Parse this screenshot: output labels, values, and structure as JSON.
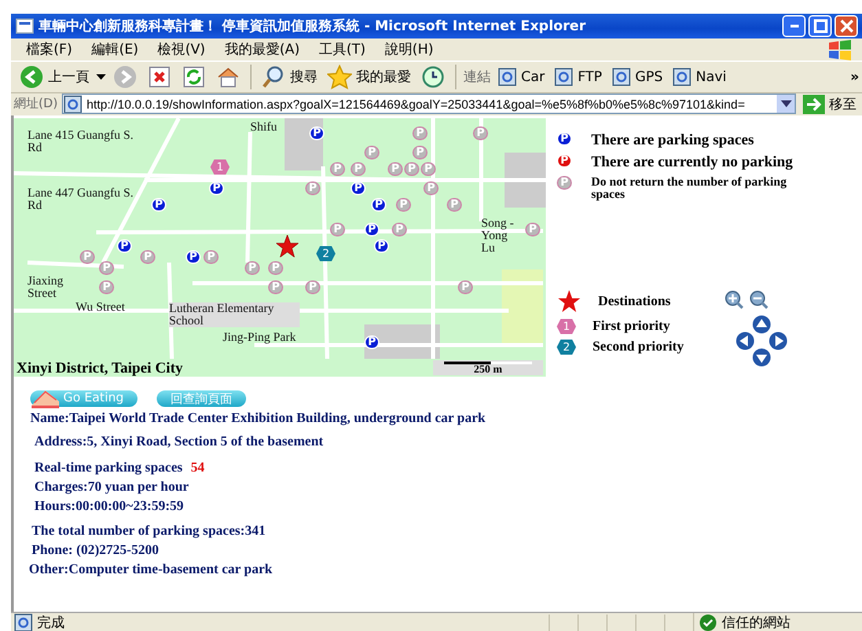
{
  "window": {
    "title": "車輛中心創新服務科專計畫！ 停車資訊加值服務系統 - Microsoft Internet Explorer"
  },
  "menu": [
    "檔案(F)",
    "編輯(E)",
    "檢視(V)",
    "我的最愛(A)",
    "工具(T)",
    "說明(H)"
  ],
  "toolbar": {
    "back": "上一頁",
    "search": "搜尋",
    "favorites": "我的最愛",
    "links_label": "連結",
    "links": [
      "Car",
      "FTP",
      "GPS",
      "Navi"
    ],
    "more": "»"
  },
  "address": {
    "label": "網址(D)",
    "value": "http://10.0.0.19/showInformation.aspx?goalX=121564469&goalY=25033441&goal=%e5%8f%b0%e5%8c%97101&kind=",
    "go": "移至"
  },
  "map": {
    "labels": [
      "Shifu",
      "Lane 415 Guangfu S. Rd",
      "Lane 447 Guangfu S. Rd",
      "Song -Yong Lu",
      "Jiaxing Street",
      "Wu Street",
      "Lutheran Elementary School",
      "Jing-Ping Park"
    ],
    "markers": [
      {
        "kind": "available",
        "label": "P"
      },
      {
        "kind": "unknown",
        "label": "P"
      },
      {
        "kind": "unknown",
        "label": "P"
      },
      {
        "kind": "unknown",
        "label": "P"
      },
      {
        "kind": "unknown",
        "label": "P"
      },
      {
        "kind": "unknown",
        "label": "P"
      },
      {
        "kind": "unknown",
        "label": "P"
      },
      {
        "kind": "unknown",
        "label": "P"
      },
      {
        "kind": "unknown",
        "label": "P"
      },
      {
        "kind": "unknown",
        "label": "P"
      },
      {
        "kind": "available",
        "label": "P"
      },
      {
        "kind": "unknown",
        "label": "P"
      },
      {
        "kind": "available",
        "label": "P"
      },
      {
        "kind": "unknown",
        "label": "P"
      },
      {
        "kind": "available",
        "label": "P"
      },
      {
        "kind": "available",
        "label": "P"
      },
      {
        "kind": "unknown",
        "label": "P"
      },
      {
        "kind": "unknown",
        "label": "P"
      },
      {
        "kind": "unknown",
        "label": "P"
      },
      {
        "kind": "available",
        "label": "P"
      },
      {
        "kind": "unknown",
        "label": "P"
      },
      {
        "kind": "unknown",
        "label": "P"
      },
      {
        "kind": "available",
        "label": "P"
      },
      {
        "kind": "available",
        "label": "P"
      },
      {
        "kind": "unknown",
        "label": "P"
      },
      {
        "kind": "unknown",
        "label": "P"
      },
      {
        "kind": "available",
        "label": "P"
      },
      {
        "kind": "unknown",
        "label": "P"
      },
      {
        "kind": "unknown",
        "label": "P"
      },
      {
        "kind": "unknown",
        "label": "P"
      },
      {
        "kind": "unknown",
        "label": "P"
      },
      {
        "kind": "unknown",
        "label": "P"
      },
      {
        "kind": "unknown",
        "label": "P"
      },
      {
        "kind": "unknown",
        "label": "P"
      },
      {
        "kind": "unknown",
        "label": "P"
      },
      {
        "kind": "available",
        "label": "P"
      }
    ],
    "priority_markers": [
      {
        "kind": "first",
        "label": "1"
      },
      {
        "kind": "second",
        "label": "2"
      }
    ],
    "caption": "Xinyi District, Taipei City",
    "scale": "250 m"
  },
  "legend": [
    {
      "kind": "available",
      "icon_label": "P",
      "text": "There are parking spaces"
    },
    {
      "kind": "full",
      "icon_label": "P",
      "text": "There are currently no parking"
    },
    {
      "kind": "unknown",
      "icon_label": "P",
      "text": "Do not return the number of parking spaces"
    }
  ],
  "legend2": [
    {
      "kind": "destination",
      "text": "Destinations"
    },
    {
      "kind": "first",
      "badge": "1",
      "text": "First priority"
    },
    {
      "kind": "second",
      "badge": "2",
      "text": "Second priority"
    }
  ],
  "buttons": [
    {
      "kind": "eating",
      "label": "Go Eating"
    },
    {
      "kind": "back",
      "label": "回查詢頁面"
    }
  ],
  "info": [
    {
      "kind": "plain",
      "text": "Name:Taipei World Trade Center Exhibition Building, underground car park"
    },
    {
      "kind": "plain",
      "text": "Address:5, Xinyi Road, Section 5 of the basement"
    },
    {
      "kind": "count",
      "text": "Real-time parking spaces",
      "value": "54"
    },
    {
      "kind": "plain",
      "text": "Charges:70 yuan per hour"
    },
    {
      "kind": "plain",
      "text": "Hours:00:00:00~23:59:59"
    },
    {
      "kind": "plain",
      "text": "The total number of parking spaces:341"
    },
    {
      "kind": "plain",
      "text": "Phone: (02)2725-5200"
    },
    {
      "kind": "plain",
      "text": "Other:Computer time-basement car park"
    }
  ],
  "status_bar": {
    "text": "完成",
    "zone": "信任的網站"
  }
}
